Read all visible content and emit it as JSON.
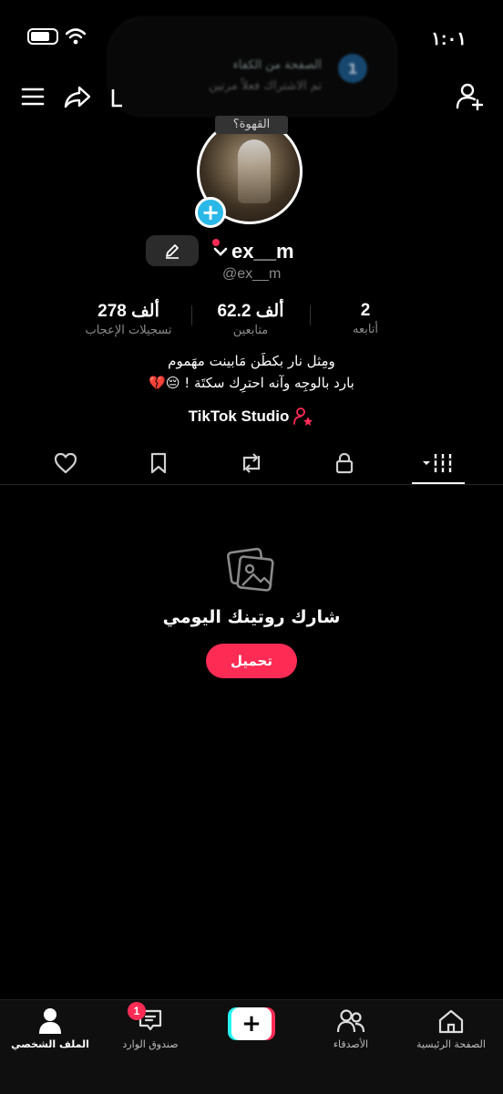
{
  "status_bar": {
    "time": "١:٠١",
    "battery_icon": "battery-icon",
    "wifi_icon": "wifi-icon"
  },
  "notification": {
    "title": "الصفحة من الكفاء",
    "subtitle": "تم الاشتراك فعلاً مرتين",
    "icon_text": "1"
  },
  "top_nav": {
    "menu_icon": "menu-icon",
    "share_icon": "share-icon",
    "add_friend_icon": "add-friend-icon"
  },
  "profile": {
    "avatar_caption": "القهوة؟",
    "display_name": "ex__m",
    "username": "@ex__m",
    "stats": [
      {
        "value": "278 ألف",
        "label": "تسجيلات الإعجاب"
      },
      {
        "value": "62.2 ألف",
        "label": "متابعين"
      },
      {
        "value": "2",
        "label": "أتابعه"
      }
    ],
    "bio_lines": [
      "ومِثل نار بكطَن مَابينت مهَموم",
      "بارد بالوجِه وآنه احترِك سكتَة ! 😔💔"
    ],
    "studio_label": "TikTok Studio"
  },
  "tabs": [
    "videos-grid-tab",
    "private-tab",
    "repost-tab",
    "favorites-tab",
    "liked-tab"
  ],
  "empty_state": {
    "title": "شارك روتينك اليومي",
    "button_label": "تحميل"
  },
  "bottom_nav": {
    "items": [
      {
        "label": "الملف الشخصي",
        "icon": "profile-icon"
      },
      {
        "label": "صندوق الوارد",
        "icon": "inbox-icon"
      },
      {
        "label": "",
        "icon": "create-plus-icon"
      },
      {
        "label": "الأصدقاء",
        "icon": "friends-icon"
      },
      {
        "label": "الصفحة الرئيسية",
        "icon": "home-icon"
      }
    ],
    "inbox_badge": "1"
  },
  "colors": {
    "accent": "#fe2c55",
    "cyan": "#25f4ee",
    "plus_badge": "#2ab8e8",
    "background": "#000000"
  }
}
